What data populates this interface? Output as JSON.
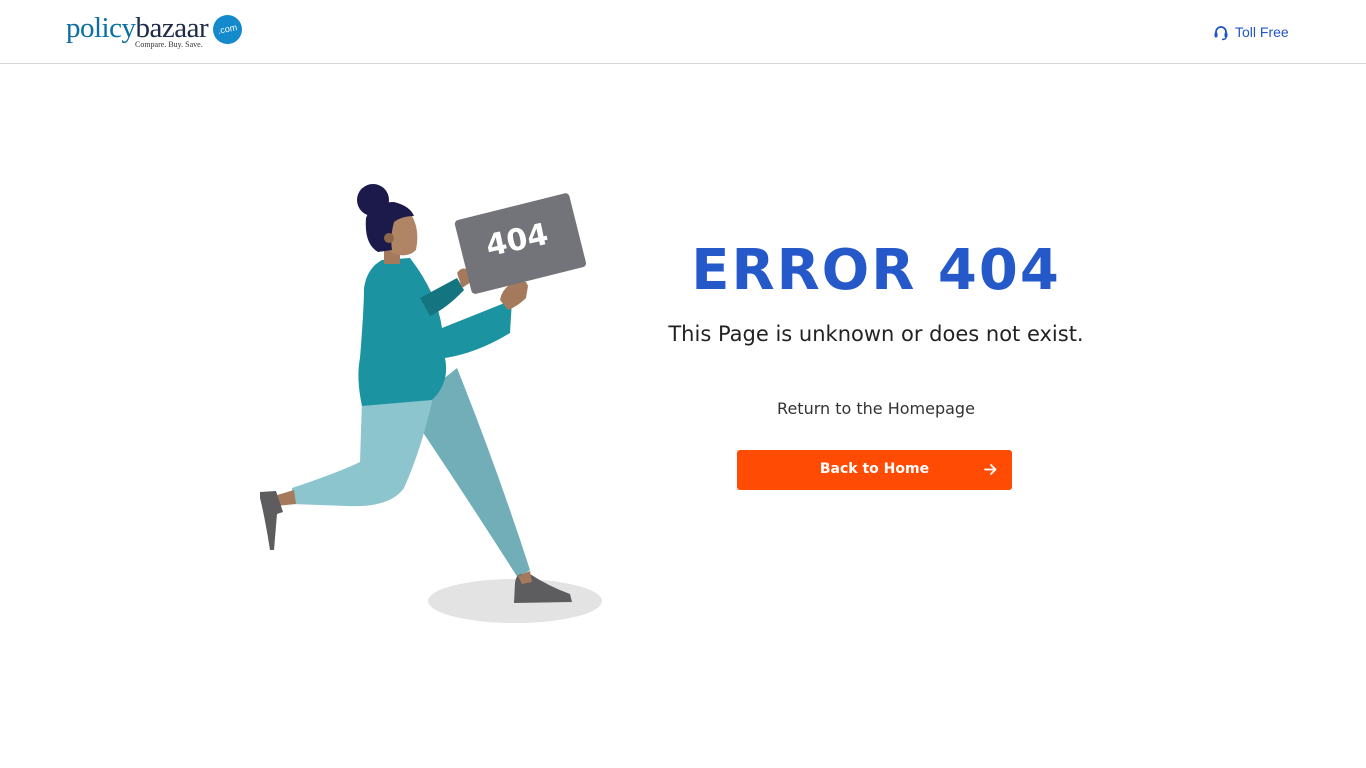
{
  "header": {
    "logo": {
      "brand_part1": "policy",
      "brand_part2": "bazaar",
      "domain_badge": ".com",
      "tagline": "Compare. Buy. Save."
    },
    "toll_free": {
      "label": "Toll Free",
      "icon": "headset-icon"
    }
  },
  "illustration": {
    "sign_text": "404",
    "description_icon": "person-holding-sign-illustration"
  },
  "main": {
    "error_title": "ERROR 404",
    "error_subtitle": "This Page is unknown or does not exist.",
    "return_text": "Return to the Homepage",
    "home_button": {
      "label": "Back to Home",
      "icon": "arrow-right-icon"
    }
  },
  "colors": {
    "brand_blue": "#0b6fa4",
    "title_blue": "#2558c8",
    "link_blue": "#1f55c4",
    "button_orange": "#ff4b03",
    "header_border": "#d6d6d6"
  }
}
